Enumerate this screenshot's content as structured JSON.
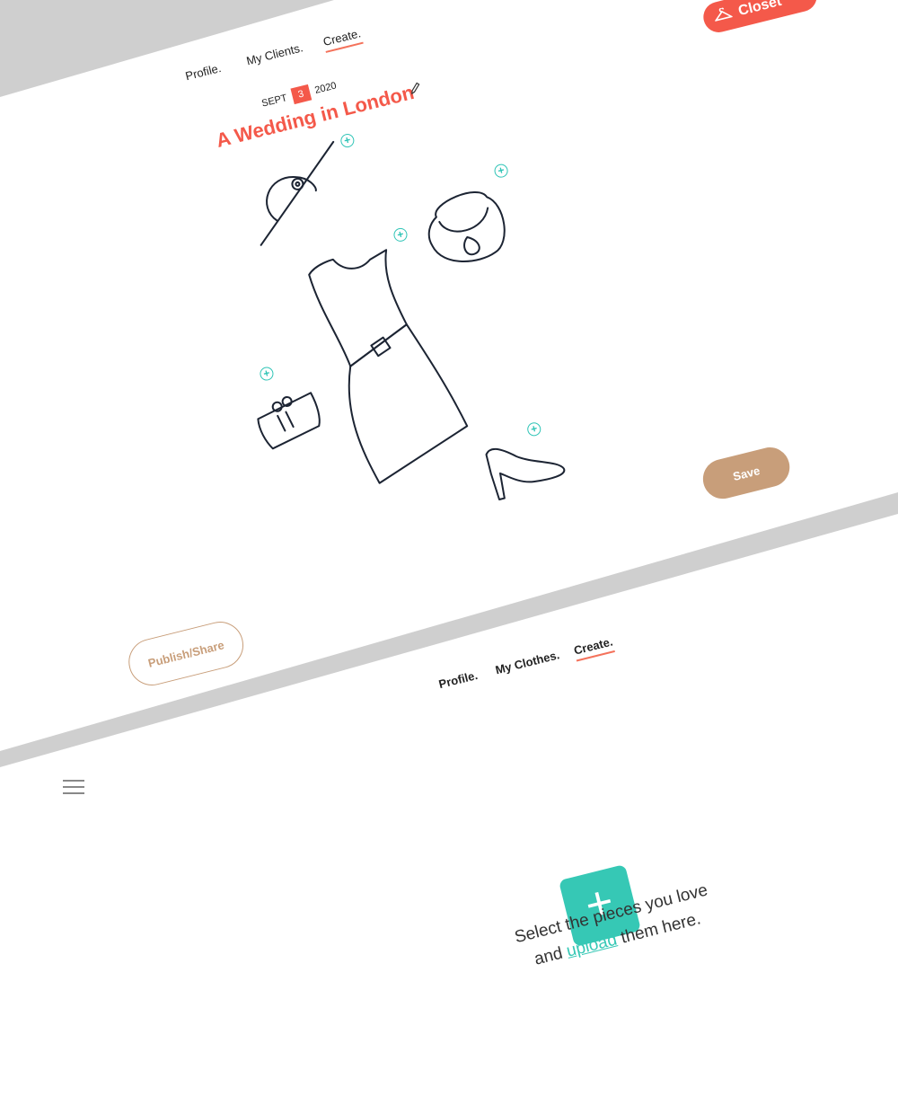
{
  "screen1": {
    "nav": [
      "Profile.",
      "My Clients.",
      "Create."
    ],
    "active_nav": "Create.",
    "closet_label": "Closet",
    "date": {
      "month": "SEPT",
      "day": "3",
      "year": "2020"
    },
    "title": "A Wedding in London",
    "save_label": "Save",
    "publish_label": "Publish/Share"
  },
  "screen2": {
    "nav": [
      "Profile.",
      "My Clients.",
      "Create."
    ],
    "nav_labels": [
      "Profile.",
      "My Clothes.",
      "Create."
    ],
    "prompt_line1": "Select the pieces you love",
    "prompt_and": "and",
    "prompt_link": "upload",
    "prompt_tail": "them here."
  },
  "colors": {
    "accent": "#f4594a",
    "teal": "#36c8b5",
    "tan": "#c89e7a"
  }
}
